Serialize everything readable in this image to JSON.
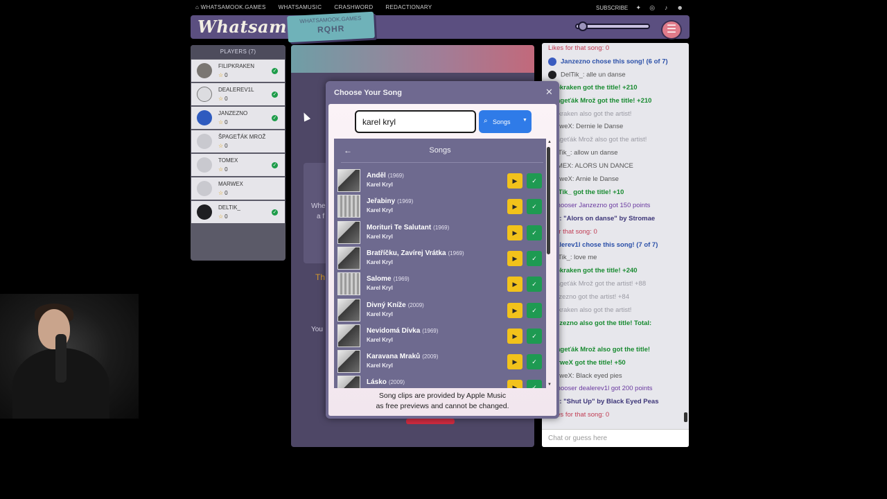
{
  "topnav": {
    "links": [
      "WHATSAMOOK.GAMES",
      "WHATSAMUSIC",
      "CRASHWORD",
      "REDACTIONARY"
    ],
    "subscribe": "SUBSCRIBE"
  },
  "header": {
    "logo": "Whatsamusic",
    "ticket_top": "WHATSAMOOK.GAMES",
    "ticket_bottom": "RQHR"
  },
  "players": {
    "title": "PLAYERS (7)",
    "items": [
      {
        "name": "FILIPKRAKEN",
        "score": "0",
        "guessed": true
      },
      {
        "name": "DEALEREV1L",
        "score": "0",
        "guessed": true
      },
      {
        "name": "JANZEZNO",
        "score": "0",
        "guessed": true
      },
      {
        "name": "ŠPAGEŤÁK MROŽ",
        "score": "0",
        "guessed": false
      },
      {
        "name": "TOMEX",
        "score": "0",
        "guessed": true
      },
      {
        "name": "MARWEX",
        "score": "0",
        "guessed": false
      },
      {
        "name": "DELTIK_",
        "score": "0",
        "guessed": true
      }
    ]
  },
  "game": {
    "fragment1": "Whe",
    "fragment2": "a f",
    "fragment3": "Th",
    "fragment4": "You"
  },
  "modal": {
    "title": "Choose Your Song",
    "search_value": "karel kryl",
    "search_type": "Songs",
    "list_title": "Songs",
    "songs": [
      {
        "title": "Anděl",
        "year": "(1969)",
        "artist": "Karel Kryl"
      },
      {
        "title": "Jeřabiny",
        "year": "(1969)",
        "artist": "Karel Kryl"
      },
      {
        "title": "Morituri Te Salutant",
        "year": "(1969)",
        "artist": "Karel Kryl"
      },
      {
        "title": "Bratříčku, Zavírej Vrátka",
        "year": "(1969)",
        "artist": "Karel Kryl"
      },
      {
        "title": "Salome",
        "year": "(1969)",
        "artist": "Karel Kryl"
      },
      {
        "title": "Divný Kníže",
        "year": "(2009)",
        "artist": "Karel Kryl"
      },
      {
        "title": "Nevidomá Dívka",
        "year": "(1969)",
        "artist": "Karel Kryl"
      },
      {
        "title": "Karavana Mraků",
        "year": "(2009)",
        "artist": "Karel Kryl"
      },
      {
        "title": "Lásko",
        "year": "(2009)",
        "artist": ""
      }
    ],
    "footer_line1": "Song clips are provided by Apple Music",
    "footer_line2": "as free previews and cannot be changed."
  },
  "chat": {
    "lines": [
      {
        "text": "Likes for that song: 0",
        "style": "c-red"
      },
      {
        "text": "Janzezno chose this song! (6 of 7)",
        "style": "c-blue"
      },
      {
        "text": "DelTik_: alle un danse",
        "style": "c-dark"
      },
      {
        "text": "filipkraken got the title! +210",
        "style": "c-green"
      },
      {
        "text": "Špageťák Mrož got the title! +210",
        "style": "c-green"
      },
      {
        "text": "filipkraken also got the artist!",
        "style": "c-faded"
      },
      {
        "text": "MarweX: Dernie le Danse",
        "style": "c-dark"
      },
      {
        "text": "Špageťák Mrož also got the artist!",
        "style": "c-faded"
      },
      {
        "text": "DelTik_: allow un danse",
        "style": "c-dark"
      },
      {
        "text": "TOMEX: ALORS UN DANCE",
        "style": "c-dark"
      },
      {
        "text": "MarweX: Arnie le Danse",
        "style": "c-dark"
      },
      {
        "text": "DelTik_ got the title! +10",
        "style": "c-green"
      },
      {
        "text": "g chooser Janzezno got 150 points",
        "style": "c-purple"
      },
      {
        "text": "wer: \"Alors on danse\" by Stromae",
        "style": "c-navy"
      },
      {
        "text": "s for that song: 0",
        "style": "c-red"
      },
      {
        "text": "dealerev1l chose this song! (7 of 7)",
        "style": "c-blue"
      },
      {
        "text": "DelTik_: love me",
        "style": "c-dark"
      },
      {
        "text": "filipkraken got the title! +240",
        "style": "c-green"
      },
      {
        "text": "Špageťák Mrož got the artist! +88",
        "style": "c-faded"
      },
      {
        "text": "Janzezno got the artist! +84",
        "style": "c-faded"
      },
      {
        "text": "filipkraken also got the artist!",
        "style": "c-faded"
      },
      {
        "text": "Janzezno also got the title! Total:",
        "style": "c-green"
      },
      {
        "text": ")",
        "style": "c-green"
      },
      {
        "text": "Špageťák Mrož also got the title!",
        "style": "c-green"
      },
      {
        "text": "MarweX got the title! +50",
        "style": "c-green"
      },
      {
        "text": "MarweX: Black eyed pies",
        "style": "c-dark"
      },
      {
        "text": "g chooser dealerev1l got 200 points",
        "style": "c-purple"
      },
      {
        "text": "wer: \"Shut Up\" by Black Eyed Peas",
        "style": "c-navy"
      },
      {
        "text": "Likes for that song: 0",
        "style": "c-red"
      }
    ],
    "placeholder": "Chat or guess here"
  },
  "colors": {
    "accent": "#2f7be8",
    "header": "#5b4f80",
    "play": "#f2c21b",
    "pick": "#1e9a52"
  }
}
